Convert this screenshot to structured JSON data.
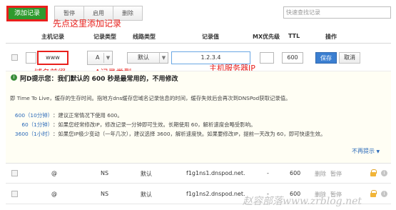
{
  "toolbar": {
    "add_label": "添加记录",
    "pause_label": "暂停",
    "enable_label": "启用",
    "delete_label": "删除",
    "search_placeholder": "快速查找记录"
  },
  "annotations": {
    "add_hint": "先点这里添加记录",
    "host_hint": "域名前缀",
    "type_hint": "A记录类型",
    "ip_hint": "主机服务器IP"
  },
  "table_header": {
    "host": "主机记录",
    "type": "记录类型",
    "line": "线路类型",
    "value": "记录值",
    "mx": "MX优先级",
    "ttl": "TTL",
    "action": "操作"
  },
  "edit_row": {
    "host": "www",
    "type": "A",
    "line": "默认",
    "value": "1.2.3.4",
    "ttl": "600",
    "save_label": "保存",
    "cancel_label": "取消"
  },
  "tips": {
    "title": "阿D提示您：我们默认的 600 秒是最常用的，不用修改",
    "intro": "即 Time To Live，缓存的生存时间。指地方dns缓存您域名记录信息的时间，缓存失效后会再次到DNSPod获取记录值。",
    "items": [
      {
        "key": "600（10分钟）",
        "text": "：建议正常情况下使用 600。"
      },
      {
        "key": "60（1分钟）",
        "text": "：如果您经常修改IP，修改记录一分钟即可生效。长期使用 60，解析速度会略受影响。"
      },
      {
        "key": "3600（1小时）",
        "text": "：如果您IP极少变动（一年几次），建议选择 3600，解析速度快。如果要修改IP，提前一天改为 60，即可快速生效。"
      }
    ],
    "more_label": "不再提示"
  },
  "records": [
    {
      "host": "@",
      "type": "NS",
      "line": "默认",
      "value": "f1g1ns1.dnspod.net.",
      "mx": "-",
      "ttl": "600",
      "delete": "删除",
      "pause": "暂停"
    },
    {
      "host": "@",
      "type": "NS",
      "line": "默认",
      "value": "f1g1ns2.dnspod.net.",
      "mx": "-",
      "ttl": "600",
      "delete": "删除",
      "pause": "暂停"
    }
  ],
  "watermark": "赵容部落www.zrblog.net",
  "colors": {
    "add_button": "#2e9a2e",
    "annotation_red": "#e8201c",
    "save_button": "#3b7fd1",
    "link_blue": "#2a69b8",
    "tips_bg": "#fffef4"
  },
  "icons": {
    "tip": "info-circle-icon",
    "lock": "lock-icon",
    "record_info": "info-icon",
    "select_arrow": "chevron-down-icon"
  }
}
